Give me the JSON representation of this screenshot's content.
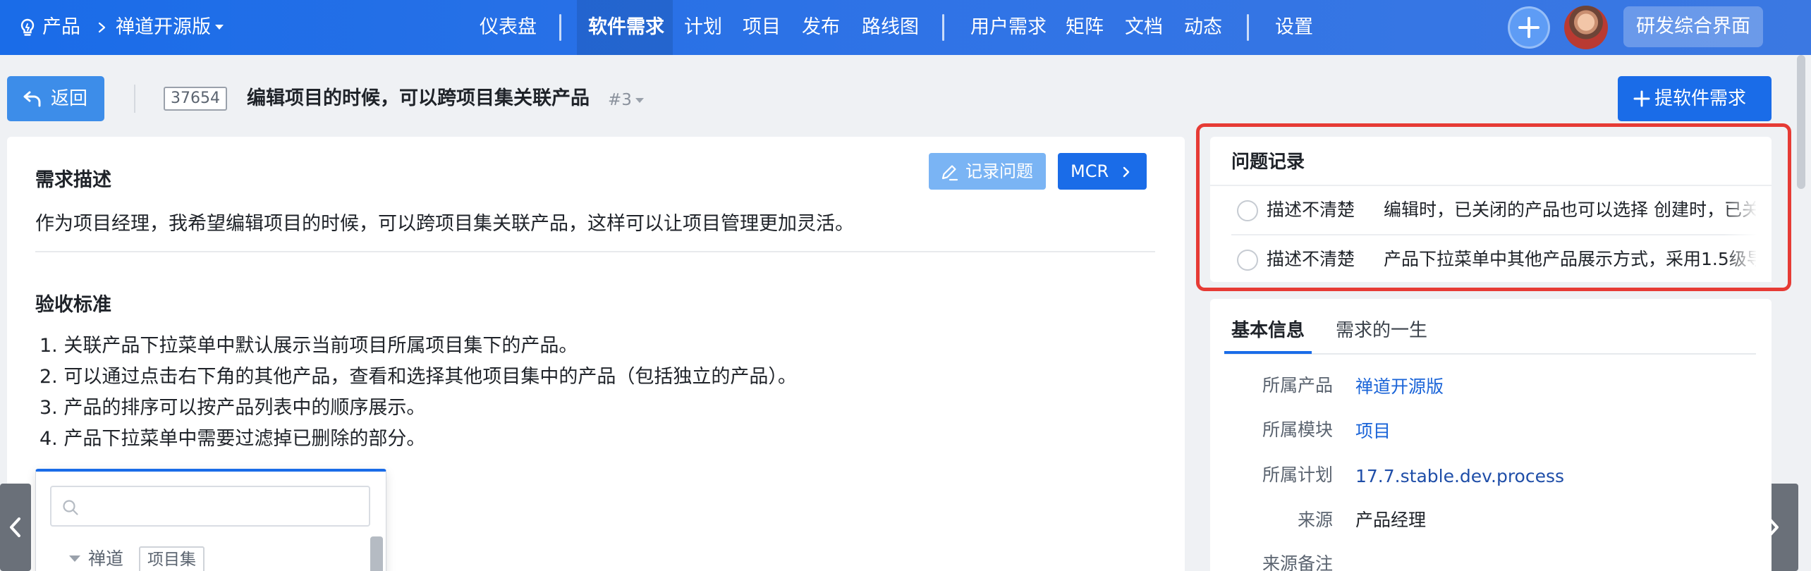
{
  "nav": {
    "breadcrumb_root": "产品",
    "product": "禅道开源版",
    "menu": {
      "dashboard": "仪表盘",
      "story": "软件需求",
      "plan": "计划",
      "project": "项目",
      "release": "发布",
      "roadmap": "路线图",
      "requirement": "用户需求",
      "matrix": "矩阵",
      "doc": "文档",
      "dynamic": "动态",
      "settings": "设置"
    },
    "active_item": "软件需求",
    "workspace": "研发综合界面"
  },
  "header": {
    "back_label": "返回",
    "story_id": "37654",
    "title": "编辑项目的时候，可以跨项目集关联产品",
    "version": "#3",
    "create_label": "提软件需求"
  },
  "main": {
    "record_label": "记录问题",
    "mcr_label": "MCR",
    "description_heading": "需求描述",
    "description": "作为项目经理，我希望编辑项目的时候，可以跨项目集关联产品，这样可以让项目管理更加灵活。",
    "criteria_heading": "验收标准",
    "criteria": [
      "1. 关联产品下拉菜单中默认展示当前项目所属项目集下的产品。",
      "2. 可以通过点击右下角的其他产品，查看和选择其他项目集中的产品（包括独立的产品）。",
      "3. 产品的排序可以按产品列表中的顺序展示。",
      "4. 产品下拉菜单中需要过滤掉已删除的部分。"
    ],
    "picker": {
      "search_placeholder": "",
      "group_name": "禅道",
      "group_tag": "项目集"
    }
  },
  "issues": {
    "heading": "问题记录",
    "items": [
      {
        "tag": "描述不清楚",
        "text": "编辑时，已关闭的产品也可以选择 创建时，已关"
      },
      {
        "tag": "描述不清楚",
        "text": "产品下拉菜单中其他产品展示方式，采用1.5级导"
      }
    ]
  },
  "info": {
    "tabs": [
      "基本信息",
      "需求的一生"
    ],
    "fields": [
      {
        "label": "所属产品",
        "value": "禅道开源版"
      },
      {
        "label": "所属模块",
        "value": "项目"
      },
      {
        "label": "所属计划",
        "value": "17.7.stable.dev.process"
      },
      {
        "label": "来源",
        "value": "产品经理"
      },
      {
        "label": "来源备注",
        "value": ""
      }
    ]
  },
  "colors": {
    "nav_gradient_start": "#1a6ce8",
    "primary": "#1a6ce8",
    "highlight_border": "#e63b35",
    "link": "#1a64d8"
  }
}
